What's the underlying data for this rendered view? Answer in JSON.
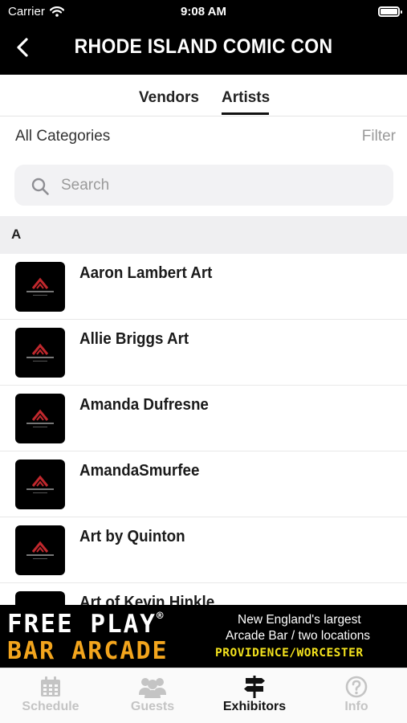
{
  "status_bar": {
    "carrier": "Carrier",
    "time": "9:08 AM"
  },
  "header": {
    "title": "RHODE ISLAND COMIC CON"
  },
  "tabs": {
    "vendors": "Vendors",
    "artists": "Artists",
    "selected": "Artists"
  },
  "filter_row": {
    "category": "All Categories",
    "filter": "Filter"
  },
  "search": {
    "placeholder": "Search",
    "value": ""
  },
  "section": {
    "letter": "A"
  },
  "artists": [
    {
      "name": "Aaron Lambert Art"
    },
    {
      "name": "Allie Briggs Art"
    },
    {
      "name": "Amanda Dufresne"
    },
    {
      "name": "AmandaSmurfee"
    },
    {
      "name": "Art by Quinton"
    },
    {
      "name": "Art of Kevin Hinkle"
    }
  ],
  "ad": {
    "line1": "FREE PLAY",
    "trademark": "®",
    "line2": "BAR ARCADE",
    "tagline1": "New England's largest",
    "tagline2": "Arcade Bar / two locations",
    "locations": "PROVIDENCE/WORCESTER"
  },
  "tab_bar": {
    "items": [
      {
        "label": "Schedule",
        "icon": "calendar-icon"
      },
      {
        "label": "Guests",
        "icon": "people-icon"
      },
      {
        "label": "Exhibitors",
        "icon": "signpost-icon",
        "active": true
      },
      {
        "label": "Info",
        "icon": "question-icon"
      }
    ]
  },
  "colors": {
    "header_bg": "#000000",
    "ad_orange": "#f3a51d",
    "ad_yellow": "#f3e21d",
    "inactive_tab": "#c4c4c4"
  }
}
